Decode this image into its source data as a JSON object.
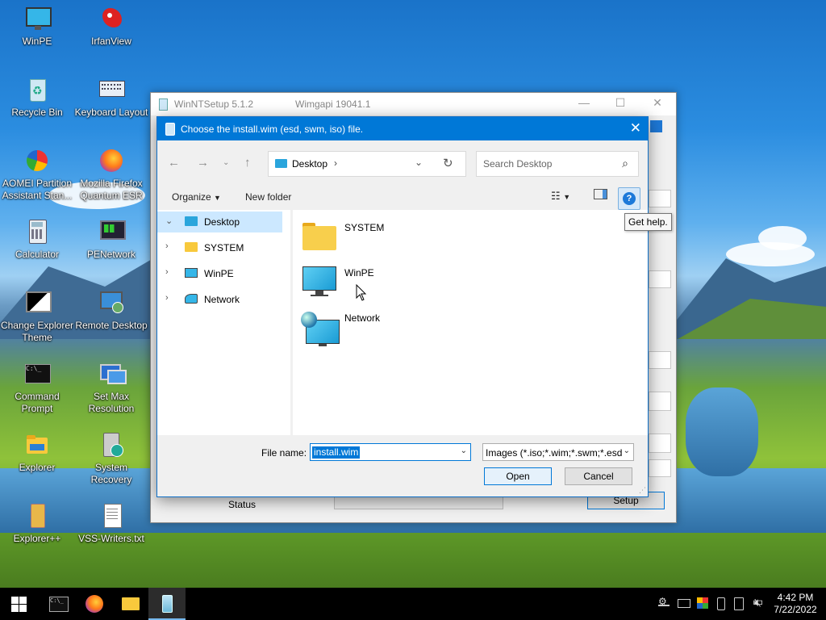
{
  "desktop": {
    "icons": [
      {
        "label": "WinPE",
        "icon": "monitor-icon"
      },
      {
        "label": "IrfanView",
        "icon": "irfanview-icon"
      },
      {
        "label": "Recycle Bin",
        "icon": "recycle-bin-icon"
      },
      {
        "label": "Keyboard Layout",
        "icon": "keyboard-icon"
      },
      {
        "label": "AOMEI Partition Assistant Stan...",
        "icon": "aomei-icon"
      },
      {
        "label": "Mozilla Firefox Quantum ESR",
        "icon": "firefox-icon"
      },
      {
        "label": "Calculator",
        "icon": "calculator-icon"
      },
      {
        "label": "PENetwork",
        "icon": "network-monitor-icon"
      },
      {
        "label": "Change Explorer Theme",
        "icon": "theme-icon"
      },
      {
        "label": "Remote Desktop",
        "icon": "remote-desktop-icon"
      },
      {
        "label": "Command Prompt",
        "icon": "cmd-icon"
      },
      {
        "label": "Set Max Resolution",
        "icon": "resolution-icon"
      },
      {
        "label": "Explorer",
        "icon": "folder-icon"
      },
      {
        "label": "System Recovery",
        "icon": "recovery-icon"
      },
      {
        "label": "Explorer++",
        "icon": "folder-icon"
      },
      {
        "label": "VSS-Writers.txt",
        "icon": "text-file-icon"
      }
    ]
  },
  "winnt": {
    "title": "WinNTSetup 5.1.2",
    "subtitle": "Wimgapi 19041.1",
    "status_label": "Status",
    "setup_label": "Setup"
  },
  "dialog": {
    "title": "Choose the install.wim (esd, swm, iso) file.",
    "address": "Desktop",
    "search_placeholder": "Search Desktop",
    "organize_label": "Organize",
    "new_folder_label": "New folder",
    "help_tooltip": "Get help.",
    "nav_tree": [
      {
        "label": "Desktop",
        "selected": true,
        "expanded": true
      },
      {
        "label": "SYSTEM",
        "selected": false
      },
      {
        "label": "WinPE",
        "selected": false
      },
      {
        "label": "Network",
        "selected": false
      }
    ],
    "items": [
      {
        "label": "SYSTEM",
        "icon": "folder-icon"
      },
      {
        "label": "WinPE",
        "icon": "monitor-icon"
      },
      {
        "label": "Network",
        "icon": "network-icon"
      }
    ],
    "file_name_label": "File name:",
    "file_name_value": "install.wim",
    "file_type_value": "Images (*.iso;*.wim;*.swm;*.esd",
    "open_label": "Open",
    "cancel_label": "Cancel"
  },
  "taskbar": {
    "time": "4:42 PM",
    "date": "7/22/2022"
  },
  "colors": {
    "accent": "#0078d7",
    "selection": "#cce8ff"
  }
}
